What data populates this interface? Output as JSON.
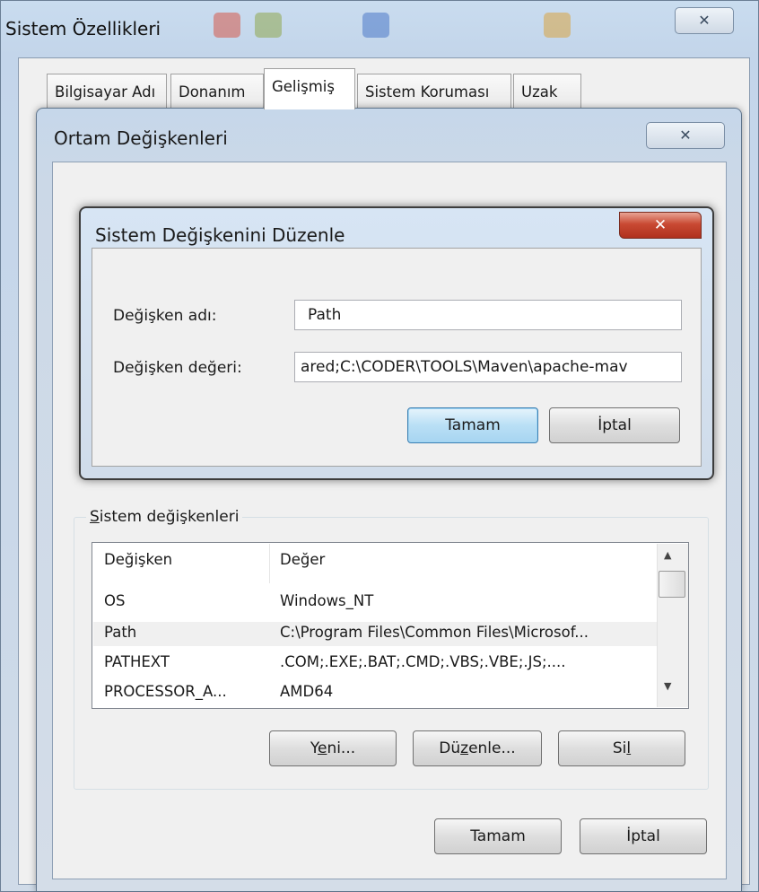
{
  "outer_window": {
    "title": "Sistem Özellikleri",
    "close_glyph": "✕",
    "tabs": [
      "Bilgisayar Adı",
      "Donanım",
      "Gelişmiş",
      "Sistem Koruması",
      "Uzak"
    ],
    "active_tab": "Gelişmiş"
  },
  "env_window": {
    "title": "Ortam Değişkenleri",
    "close_glyph": "✕"
  },
  "edit_dialog": {
    "title": "Sistem Değişkenini Düzenle",
    "close_glyph": "✕",
    "name_label": "Değişken adı:",
    "name_value": "Path",
    "value_label": "Değişken değeri:",
    "value_value": "ared;C:\\CODER\\TOOLS\\Maven\\apache-mav",
    "ok_label": "Tamam",
    "cancel_label": "İptal"
  },
  "system_vars": {
    "group_label_first": "S",
    "group_label_rest": "istem değişkenleri",
    "columns": [
      "Değişken",
      "Değer"
    ],
    "rows": [
      {
        "name": "OS",
        "value": "Windows_NT"
      },
      {
        "name": "Path",
        "value": "C:\\Program Files\\Common Files\\Microsof..."
      },
      {
        "name": "PATHEXT",
        "value": ".COM;.EXE;.BAT;.CMD;.VBS;.VBE;.JS;...."
      },
      {
        "name": "PROCESSOR_A...",
        "value": "AMD64"
      }
    ],
    "selected_row": 1,
    "new_btn": {
      "pre": "Y",
      "ul": "e",
      "post": "ni..."
    },
    "edit_btn": {
      "pre": "Dü",
      "ul": "z",
      "post": "enle..."
    },
    "delete_btn": {
      "pre": "Si",
      "ul": "l",
      "post": ""
    }
  },
  "footer": {
    "ok_label": "Tamam",
    "cancel_label": "İptal"
  },
  "colors": {
    "title_bar": "#c6d7ea",
    "dialog_close": "#c94a33",
    "default_button": "#b9dff5"
  }
}
